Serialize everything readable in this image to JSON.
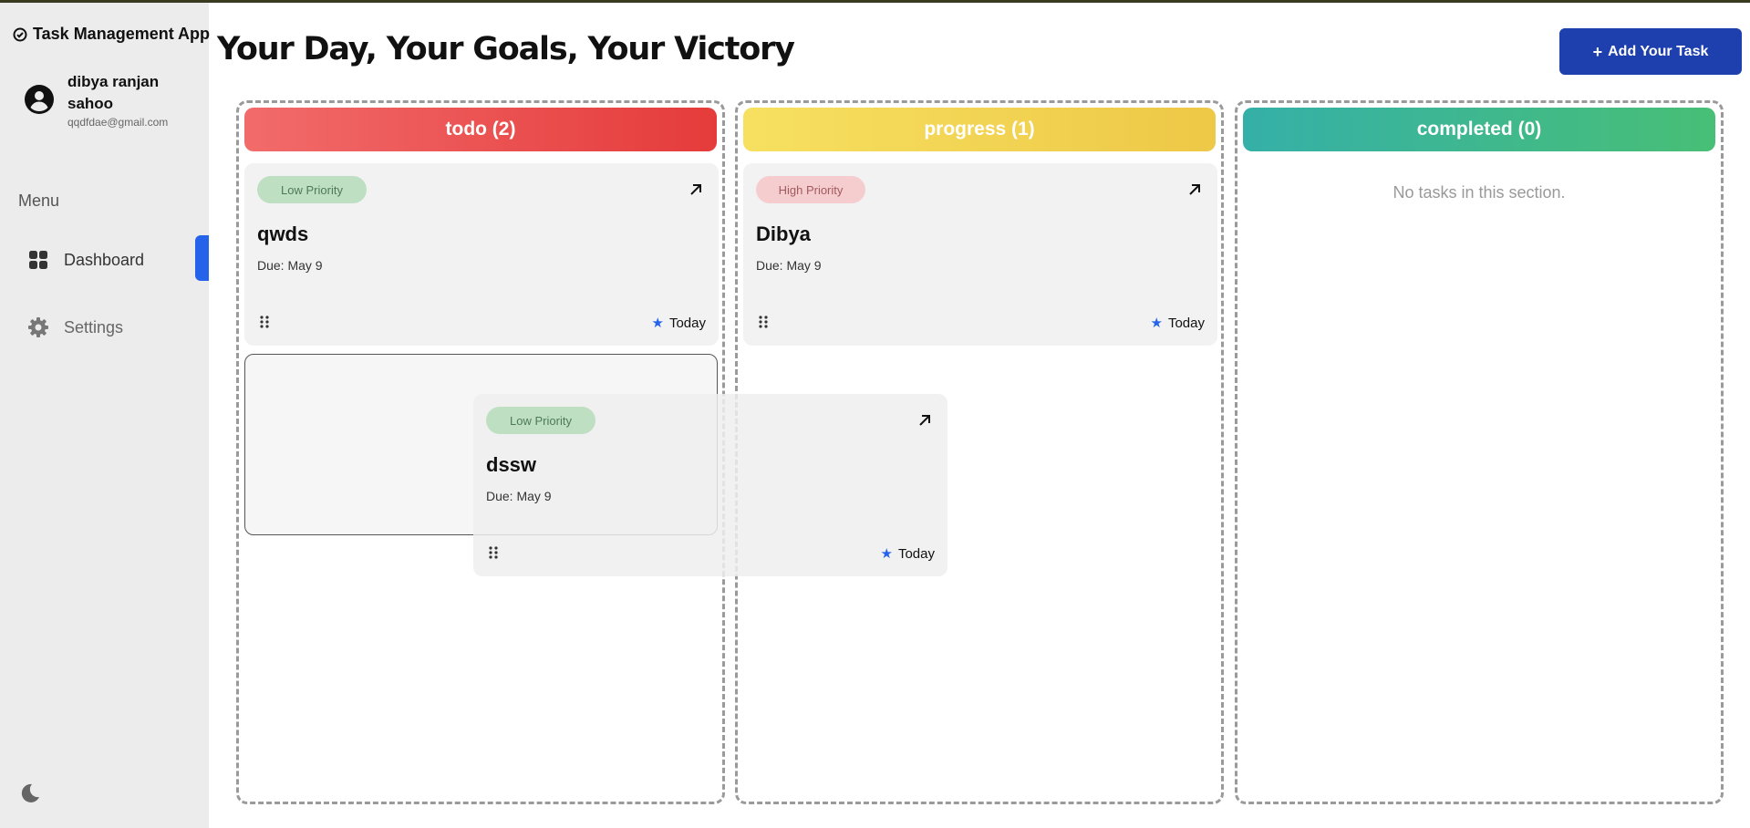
{
  "app": {
    "title": "Task Management App"
  },
  "user": {
    "name": "dibya ranjan sahoo",
    "email": "qqdfdae@gmail.com"
  },
  "sidebar": {
    "menu_label": "Menu",
    "items": [
      {
        "label": "Dashboard",
        "icon": "dashboard-icon",
        "active": true
      },
      {
        "label": "Settings",
        "icon": "gear-icon",
        "active": false
      }
    ],
    "theme_icon": "moon-icon"
  },
  "header": {
    "title": "Your Day, Your Goals, Your Victory",
    "add_button": {
      "icon": "plus",
      "label": "Add Your Task"
    }
  },
  "columns": [
    {
      "key": "todo",
      "title": "todo (2)",
      "colors": [
        "#f26b6b",
        "#e53b3b"
      ],
      "tasks": [
        {
          "priority": "Low Priority",
          "title": "qwds",
          "due": "Due: May 9",
          "tag": "Today"
        }
      ]
    },
    {
      "key": "progress",
      "title": "progress (1)",
      "colors": [
        "#f7e060",
        "#eec847"
      ],
      "tasks": [
        {
          "priority": "High Priority",
          "title": "Dibya",
          "due": "Due: May 9",
          "tag": "Today"
        }
      ]
    },
    {
      "key": "completed",
      "title": "completed (0)",
      "colors": [
        "#35b0a8",
        "#48bf76"
      ],
      "tasks": [],
      "empty_message": "No tasks in this section."
    }
  ],
  "dragging_task": {
    "priority": "Low Priority",
    "title": "dssw",
    "due": "Due: May 9",
    "tag": "Today"
  },
  "colors": {
    "accent": "#2563eb",
    "button": "#1e3fae",
    "low_priority": "#bfdfc3",
    "high_priority": "#f6cdcf"
  }
}
